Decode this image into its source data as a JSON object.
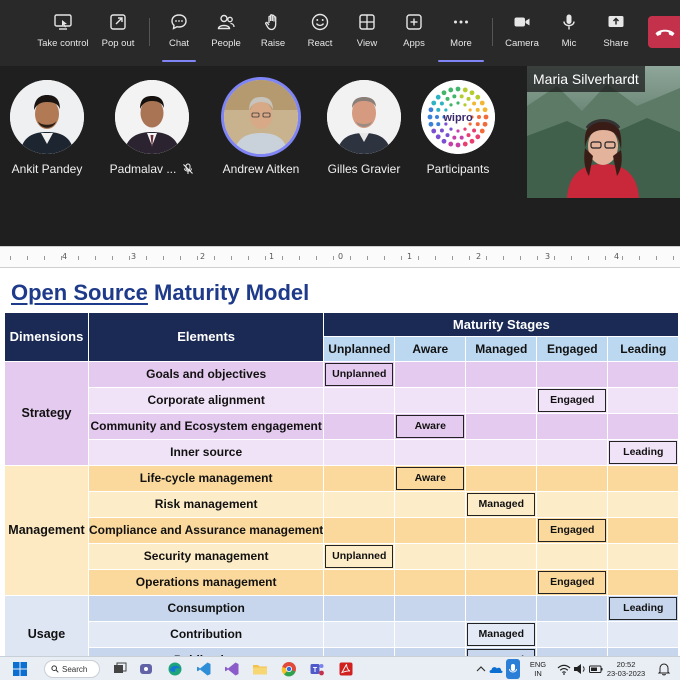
{
  "toolbar": {
    "take_control": "Take control",
    "pop_out": "Pop out",
    "chat": "Chat",
    "people": "People",
    "raise": "Raise",
    "react": "React",
    "view": "View",
    "apps": "Apps",
    "more": "More",
    "camera": "Camera",
    "mic": "Mic",
    "share": "Share"
  },
  "participants": [
    {
      "name": "Ankit Pandey"
    },
    {
      "name": "Padmalav ..."
    },
    {
      "name": "Andrew Aitken"
    },
    {
      "name": "Gilles Gravier"
    },
    {
      "name": "Participants",
      "logo_text": "wipro"
    }
  ],
  "video_name": "Maria Silverhardt",
  "ruler_numbers": [
    "4",
    "3",
    "2",
    "1",
    "0",
    "1",
    "2",
    "3",
    "4"
  ],
  "slide": {
    "title_part1": "Open Source",
    "title_part2": " Maturity Model",
    "headers": {
      "dimensions": "Dimensions",
      "elements": "Elements",
      "maturity_stages": "Maturity Stages",
      "stages": [
        "Unplanned",
        "Aware",
        "Managed",
        "Engaged",
        "Leading"
      ]
    },
    "groups": [
      {
        "dimension": "Strategy",
        "rows": [
          {
            "element": "Goals and objectives",
            "stage_index": 0,
            "label": "Unplanned"
          },
          {
            "element": "Corporate alignment",
            "stage_index": 3,
            "label": "Engaged"
          },
          {
            "element": "Community and Ecosystem engagement",
            "stage_index": 1,
            "label": "Aware"
          },
          {
            "element": "Inner source",
            "stage_index": 4,
            "label": "Leading"
          }
        ]
      },
      {
        "dimension": "Management",
        "rows": [
          {
            "element": "Life-cycle management",
            "stage_index": 1,
            "label": "Aware"
          },
          {
            "element": "Risk management",
            "stage_index": 2,
            "label": "Managed"
          },
          {
            "element": "Compliance and Assurance management",
            "stage_index": 3,
            "label": "Engaged"
          },
          {
            "element": "Security management",
            "stage_index": 0,
            "label": "Unplanned"
          },
          {
            "element": "Operations management",
            "stage_index": 3,
            "label": "Engaged"
          }
        ]
      },
      {
        "dimension": "Usage",
        "rows": [
          {
            "element": "Consumption",
            "stage_index": 4,
            "label": "Leading"
          },
          {
            "element": "Contribution",
            "stage_index": 2,
            "label": "Managed"
          },
          {
            "element": "Publication",
            "stage_index": 2,
            "label": "Managed"
          }
        ]
      }
    ]
  },
  "taskbar": {
    "search": "Search",
    "lang_line1": "ENG",
    "lang_line2": "IN",
    "time": "20:52",
    "date": "23-03-2023"
  },
  "colors": {
    "accent": "#7f85f5",
    "hangup": "#c4314b",
    "header_navy": "#1b2a55",
    "title_blue": "#1e3a8a"
  }
}
